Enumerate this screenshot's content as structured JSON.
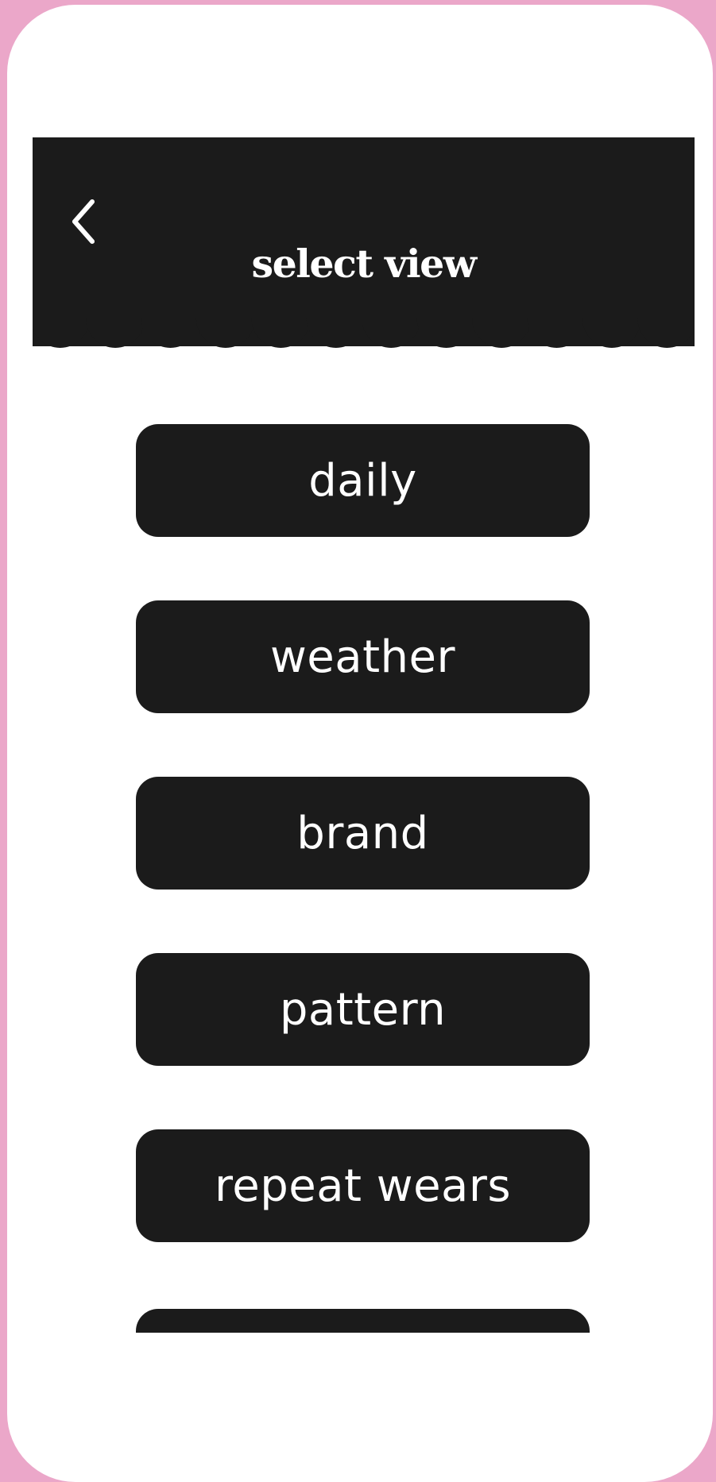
{
  "header": {
    "title": "select view",
    "back_icon": "chevron-left-icon"
  },
  "options": [
    {
      "label": "daily"
    },
    {
      "label": "weather"
    },
    {
      "label": "brand"
    },
    {
      "label": "pattern"
    },
    {
      "label": "repeat wears"
    }
  ],
  "colors": {
    "background": "#eba7c9",
    "surface": "#ffffff",
    "dark": "#1b1b1b",
    "text_on_dark": "#ffffff"
  }
}
